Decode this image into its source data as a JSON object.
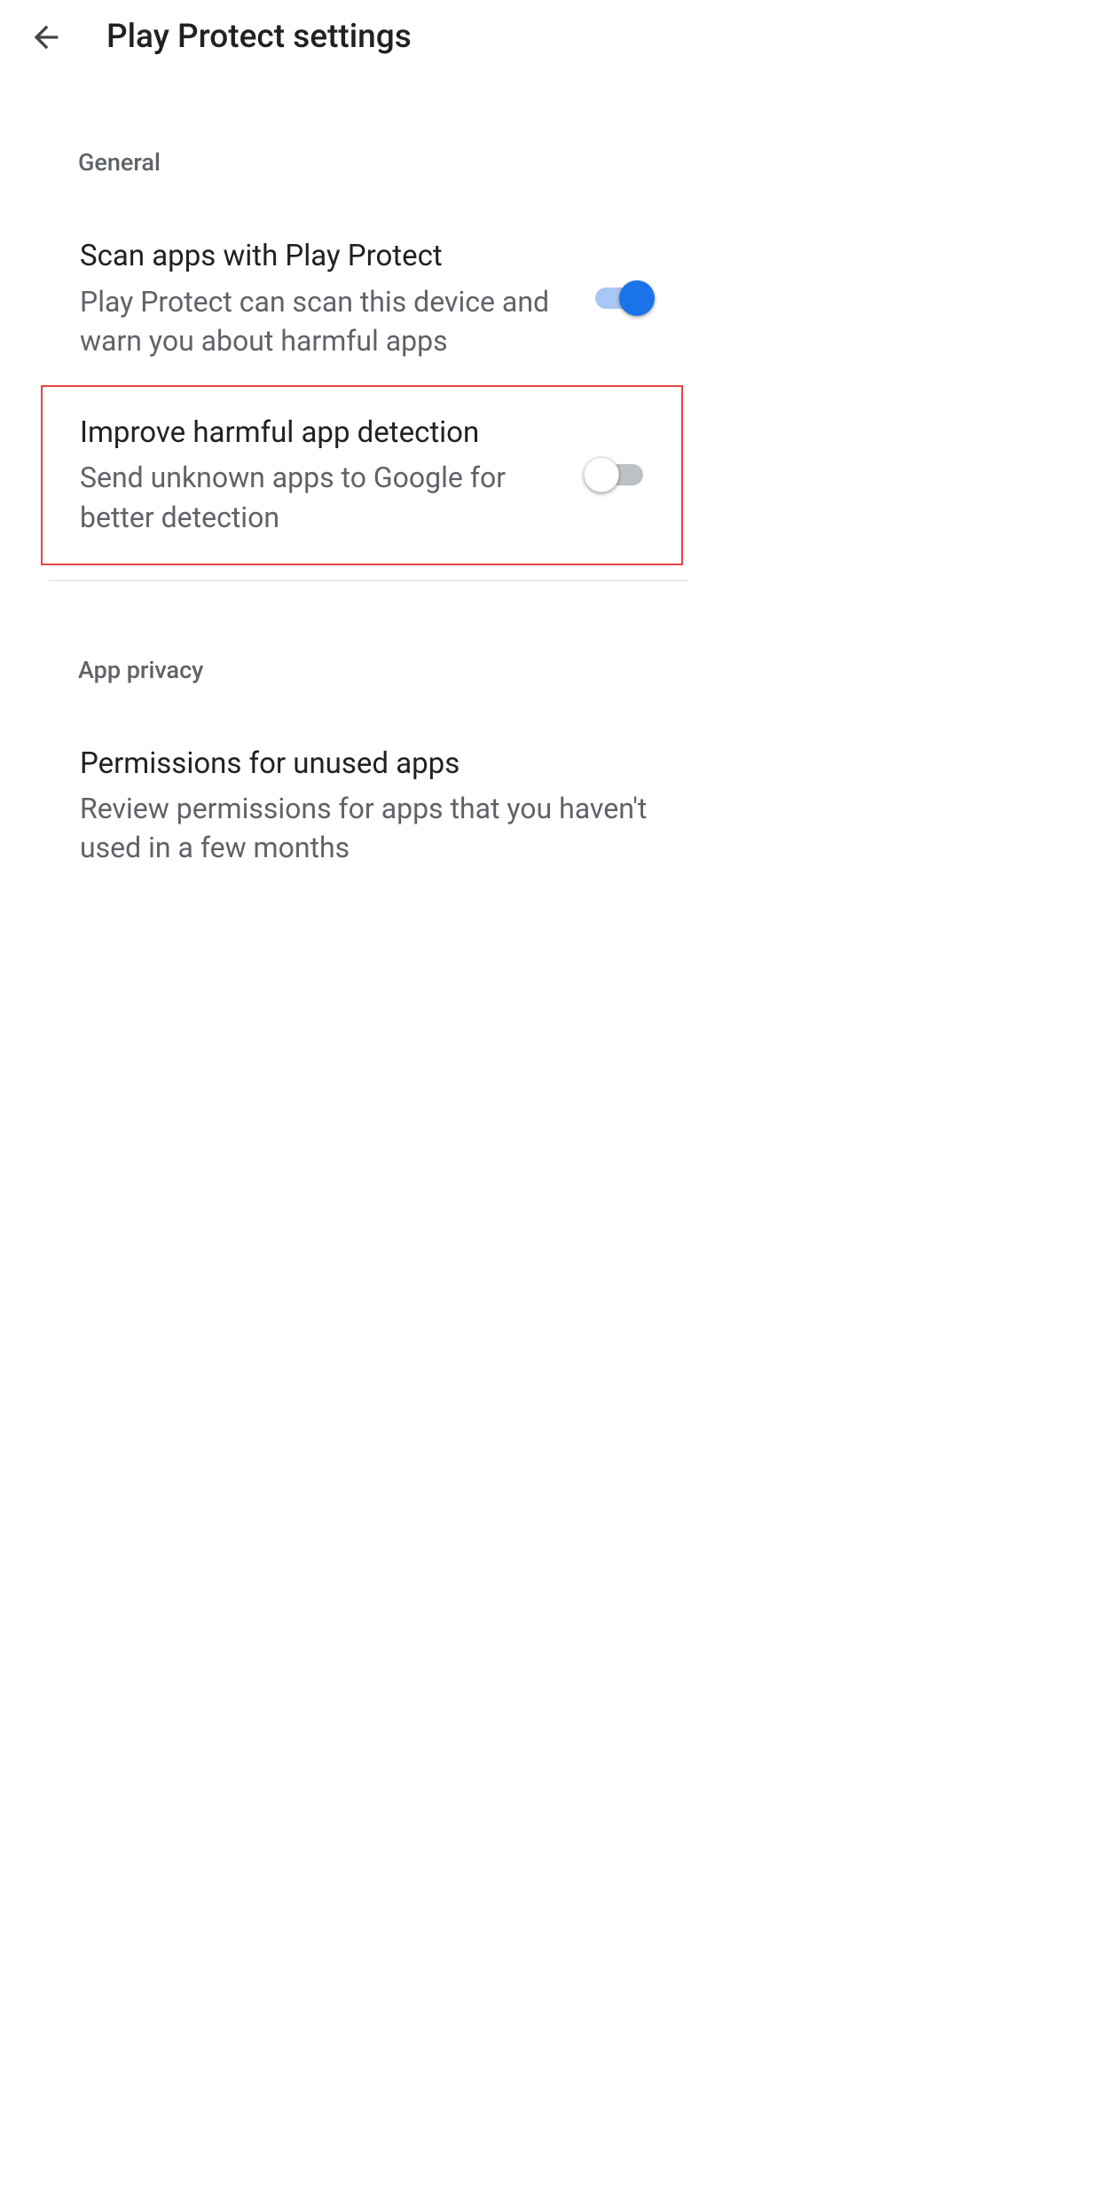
{
  "header": {
    "title": "Play Protect settings"
  },
  "sections": {
    "general": {
      "label": "General",
      "scan": {
        "title": "Scan apps with Play Protect",
        "description": "Play Protect can scan this device and warn you about harmful apps",
        "enabled": true
      },
      "improve": {
        "title": "Improve harmful app detection",
        "description": "Send unknown apps to Google for better detection",
        "enabled": false
      }
    },
    "privacy": {
      "label": "App privacy",
      "permissions": {
        "title": "Permissions for unused apps",
        "description": "Review permissions for apps that you haven't used in a few months"
      }
    }
  }
}
